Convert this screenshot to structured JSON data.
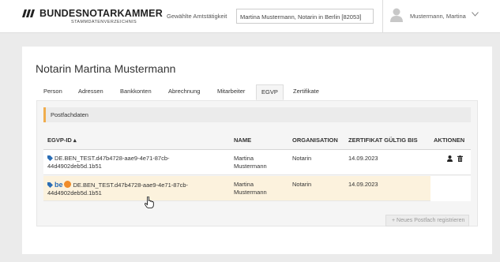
{
  "header": {
    "brand_title": "BUNDESNOTARKAMMER",
    "brand_subtitle": "STAMMDATENVERZEICHNIS",
    "office_label": "Gewählte Amtstätigkeit",
    "office_value": "Martina Mustermann, Notarin in Berlin [82053]",
    "user_name": "Mustermann, Martina"
  },
  "page": {
    "title": "Notarin Martina Mustermann"
  },
  "tabs": [
    {
      "label": "Person"
    },
    {
      "label": "Adressen"
    },
    {
      "label": "Bankkonten"
    },
    {
      "label": "Abrechnung"
    },
    {
      "label": "Mitarbeiter"
    },
    {
      "label": "EGVP",
      "active": true
    },
    {
      "label": "Zertifikate"
    }
  ],
  "section": {
    "title": "Postfachdaten"
  },
  "table": {
    "headers": {
      "id": "EGVP-ID ▴",
      "name": "NAME",
      "org": "ORGANISATION",
      "cert": "ZERTIFIKAT GÜLTIG BIS",
      "actions": "AKTIONEN"
    },
    "rows": [
      {
        "id_line1": "DE.BEN_TEST.d47b4728-aae9-4e71-87cb-",
        "id_line2": "44d4902deb5d.1b51",
        "name_line1": "Martina",
        "name_line2": "Mustermann",
        "org": "Notarin",
        "cert": "14.09.2023"
      },
      {
        "badge": "be",
        "id_line1": "DE.BEN_TEST.d47b4728-aae9-4e71-87cb-",
        "id_line2": "44d4902deb5d.1b51",
        "name_line1": "Martina",
        "name_line2": "Mustermann",
        "org": "Notarin",
        "cert": "14.09.2023"
      }
    ]
  },
  "actions": {
    "register_label": "+ Neues Postfach registrieren"
  },
  "colors": {
    "accent": "#f0ad4e",
    "tag": "#2a6db5",
    "selected_row": "#fcf2dd"
  },
  "icons": [
    "user-icon",
    "chevron-down-icon",
    "tag-icon",
    "person-icon",
    "trash-icon",
    "hand-cursor-icon"
  ]
}
